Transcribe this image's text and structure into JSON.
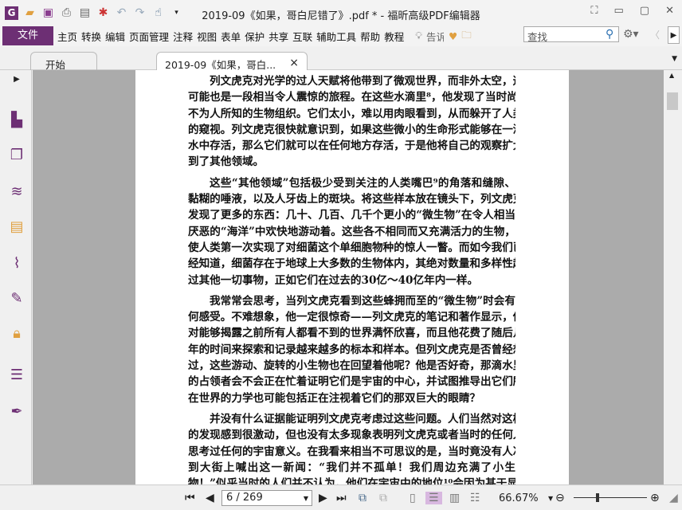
{
  "window": {
    "title": "2019-09《如果，哥白尼错了》.pdf * - 福昕高级PDF编辑器"
  },
  "menu": {
    "file": "文件",
    "items": [
      "主页",
      "转换",
      "编辑",
      "页面管理",
      "注释",
      "视图",
      "表单",
      "保护",
      "共享",
      "互联",
      "辅助工具",
      "帮助",
      "教程"
    ],
    "tell": "告诉",
    "search_placeholder": "查找"
  },
  "tabs": [
    {
      "label": "开始"
    },
    {
      "label": "2019-09《如果，哥白...",
      "close": "×"
    }
  ],
  "document": {
    "paragraphs": [
      [
        "列文虎克对光学的过人天赋将他带到了微观世界，而非外太空，这",
        "可能也是一段相当令人震惊的旅程。在这些水滴里⁸，他发现了当时尚",
        "不为人所知的生物组织。它们太小，难以用肉眼看到，从而躲开了人类",
        "的窥视。列文虎克很快就意识到，如果这些微小的生命形式能够在一滴",
        "水中存活，那么它们就可以在任何地方存活，于是他将自己的观察扩大",
        "到了其他领域。"
      ],
      [
        "这些“其他领域”包括极少受到关注的人类嘴巴⁹的角落和缝隙、",
        "黏糊的唾液，以及人牙齿上的斑块。将这些样本放在镜头下，列文虎克",
        "发现了更多的东西：几十、几百、几千个更小的“微生物”在令人相当",
        "厌恶的“海洋”中欢快地游动着。这些各不相同而又充满活力的生物，",
        "使人类第一次实现了对细菌这个单细胞物种的惊人一瞥。而如今我们已",
        "经知道，细菌存在于地球上大多数的生物体内，其绝对数量和多样性超",
        "过其他一切事物，正如它们在过去的30亿～40亿年内一样。"
      ],
      [
        "我常常会思考，当列文虎克看到这些蜂拥而至的“微生物”时会有",
        "何感受。不难想象，他一定很惊奇——列文虎克的笔记和著作显示，他",
        "对能够揭露之前所有人都看不到的世界满怀欣喜，而且他花费了随后几",
        "年的时间来探索和记录越来越多的标本和样本。但列文虎克是否曾经想",
        "过，这些游动、旋转的小生物也在回望着他呢？他是否好奇，那滴水里",
        "的占领者会不会正在忙着证明它们是宇宙的中心，并试图推导出它们所",
        "在世界的力学也可能包括正在注视着它们的那双巨大的眼睛？"
      ],
      [
        "并没有什么证据能证明列文虎克考虑过这些问题。人们当然对这样",
        "的发现感到很激动，但也没有太多现象表明列文虎克或者当时的任何人",
        "思考过任何的宇宙意义。在我看来相当不可思议的是，当时竟没有人冲",
        "到大街上喊出这一新闻：“我们并不孤单！我们周边充满了小生",
        "物！”似乎当时的人们并不认为，他们在宇宙中的地位¹⁰会因为甚于显"
      ]
    ]
  },
  "status": {
    "page": "6 / 269",
    "zoom": "66.67%"
  }
}
